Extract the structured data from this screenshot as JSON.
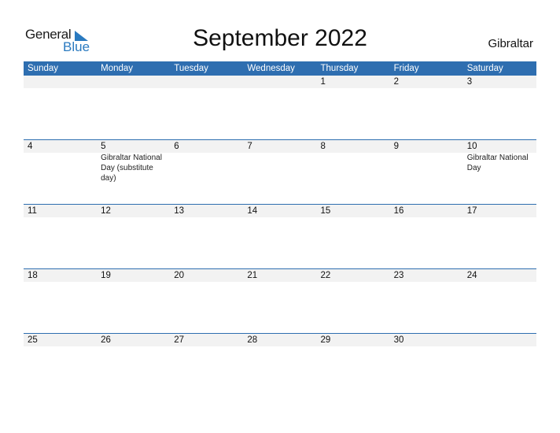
{
  "logo": {
    "line1": "General",
    "line2": "Blue",
    "accent_color": "#2a7ac0"
  },
  "title": "September 2022",
  "country": "Gibraltar",
  "header_color": "#2e6eb0",
  "weekdays": [
    "Sunday",
    "Monday",
    "Tuesday",
    "Wednesday",
    "Thursday",
    "Friday",
    "Saturday"
  ],
  "weeks": [
    {
      "days": [
        "",
        "",
        "",
        "",
        "1",
        "2",
        "3"
      ],
      "events": [
        "",
        "",
        "",
        "",
        "",
        "",
        ""
      ]
    },
    {
      "days": [
        "4",
        "5",
        "6",
        "7",
        "8",
        "9",
        "10"
      ],
      "events": [
        "",
        "Gibraltar National Day (substitute day)",
        "",
        "",
        "",
        "",
        "Gibraltar National Day"
      ]
    },
    {
      "days": [
        "11",
        "12",
        "13",
        "14",
        "15",
        "16",
        "17"
      ],
      "events": [
        "",
        "",
        "",
        "",
        "",
        "",
        ""
      ]
    },
    {
      "days": [
        "18",
        "19",
        "20",
        "21",
        "22",
        "23",
        "24"
      ],
      "events": [
        "",
        "",
        "",
        "",
        "",
        "",
        ""
      ]
    },
    {
      "days": [
        "25",
        "26",
        "27",
        "28",
        "29",
        "30",
        ""
      ],
      "events": [
        "",
        "",
        "",
        "",
        "",
        "",
        ""
      ]
    }
  ]
}
